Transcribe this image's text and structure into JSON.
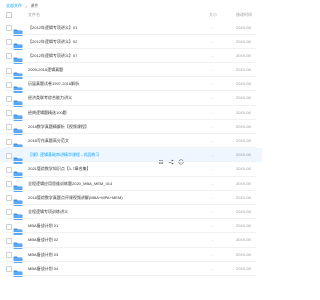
{
  "breadcrumb": {
    "parent": "全部文件",
    "separator": ">",
    "current": "课件"
  },
  "header": {
    "name": "文件名",
    "size": "大小",
    "date": "修改时间"
  },
  "colors": {
    "accent": "#06a7ff",
    "folder": "#5aa8f8",
    "folder_tab": "#3f91e8",
    "selected_bg": "#eef6ff"
  },
  "files": [
    {
      "name": "【2012年逻辑专项讲义】01",
      "size": "-",
      "date": "2019-08"
    },
    {
      "name": "【2012年逻辑专项讲义】02",
      "size": "-",
      "date": "2019-08"
    },
    {
      "name": "【2012年逻辑专项讲义】07",
      "size": "-",
      "date": "2019-08"
    },
    {
      "name": "2009-2016逻辑真题",
      "size": "-",
      "date": "2019-08"
    },
    {
      "name": "历届真题试卷1997-2016解析",
      "size": "-",
      "date": "2019-08"
    },
    {
      "name": "经济类联考综合能力讲义",
      "size": "-",
      "date": "2019-08"
    },
    {
      "name": "经典逻辑题精选100题",
      "size": "-",
      "date": "2019-08"
    },
    {
      "name": "2018数学真题精解析【视频课程】",
      "size": "-",
      "date": "2019-08"
    },
    {
      "name": "2018写作真题高分范文",
      "size": "-",
      "date": "2019-08"
    },
    {
      "name": "【课】逻辑基础串讲精华课程 - 巩固练习",
      "size": "-",
      "date": "2019-08",
      "selected": true
    },
    {
      "name": "2021管综数学知识点【1-7章合集】",
      "size": "-",
      "date": "2019-08"
    },
    {
      "name": "全程逻辑应用思维训练题2020_MBA_MEM_014",
      "size": "-",
      "date": "2019-08"
    },
    {
      "name": "2018管综数学真题点评课视频讲解(MBA+MPA+MEM)",
      "size": "-",
      "date": "2019-08"
    },
    {
      "name": "全程逻辑专项训练讲义",
      "size": "-",
      "date": "2019-08"
    },
    {
      "name": "MBA备战计划 01",
      "size": "-",
      "date": "2019-08"
    },
    {
      "name": "MBA备战计划 02",
      "size": "-",
      "date": "2019-08"
    },
    {
      "name": "MBA备战计划 03",
      "size": "-",
      "date": "2019-08"
    },
    {
      "name": "MBA备战计划 04",
      "size": "-",
      "date": "2019-08"
    }
  ],
  "row_actions": [
    {
      "icon": "share-icon"
    },
    {
      "icon": "link-icon"
    },
    {
      "icon": "more-icon"
    }
  ]
}
